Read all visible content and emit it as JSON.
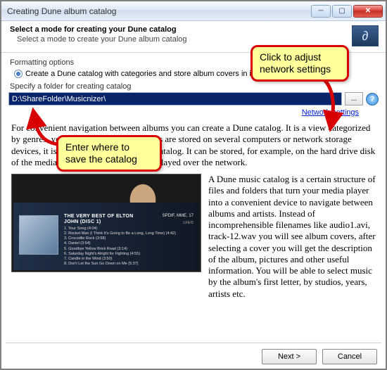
{
  "window": {
    "title": "Creating Dune album catalog"
  },
  "header": {
    "title": "Select a mode for creating your Dune catalog",
    "subtitle": "Select a mode to create your Dune album catalog"
  },
  "formatting": {
    "label": "Formatting options",
    "radio_label": "Create a Dune catalog with categories and store album covers in it"
  },
  "path": {
    "label": "Specify a folder for creating catalog",
    "value": "D:\\ShareFolder\\Musicnizer\\",
    "browse_label": "...",
    "help_label": "?"
  },
  "links": {
    "network_settings": "Network settings"
  },
  "paragraph1": "For convenient navigation between albums you can create a Dune catalog. It is a view categorized by genres, years, artists etc. If the albums are stored on several computers or network storage devices, it is possible to create a single catalog. It can be stored, for example, on the hard drive disk of the media player, and albums can be played over the network.",
  "paragraph2": "A Dune music catalog is a certain structure of files and folders that turn your media player into a convenient device to navigate between albums and artists. Instead of incomprehensible filenames like audio1.avi, track-12.wav you will see album covers, after selecting a cover you will get the description of the album, pictures and other useful information. You will be able to select music by the album's first letter, by studios, years, artists etc.",
  "screenshot": {
    "album_title_line1": "THE VERY BEST OF ELTON",
    "album_title_line2": "JOHN (DISC 1)",
    "right1": "SPDIF, MME, 17",
    "right2": "LFE/2",
    "tracks": "1. Your Song (4:04)\n2. Rocket Man (I Think It's Going to Be a Long, Long Time) (4:42)\n3. Crocodile Rock (3:58)\n4. Daniel (3:54)\n5. Goodbye Yellow Brick Road (3:14)\n6. Saturday Night's Alright for Fighting (4:55)\n7. Candle in the Wind (3:50)\n8. Don't Let the Sun Go Down on Me (5:37)"
  },
  "buttons": {
    "next": "Next >",
    "cancel": "Cancel"
  },
  "callouts": {
    "save": "Enter where to save the catalog",
    "network": "Click to adjust network settings"
  }
}
